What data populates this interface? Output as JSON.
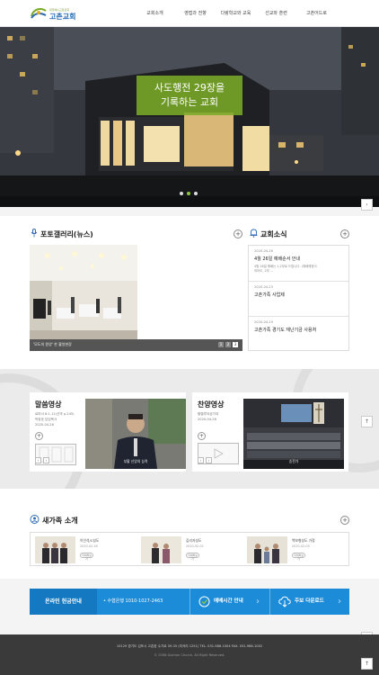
{
  "header": {
    "logo_sub": "대한예수교장로회",
    "logo_text": "고촌교회",
    "nav": [
      "교회소개",
      "영접과 전향",
      "다랑학교와 교육",
      "선교와 훈련",
      "고촌어드로"
    ]
  },
  "hero": {
    "caption_line1": "사도행전 29장을",
    "caption_line2": "기록하는 교회",
    "next_label": "›"
  },
  "photo_gallery": {
    "title": "포토갤러리(뉴스)",
    "caption": "'모도의 원양' 한 활영현장",
    "pager": [
      "1",
      "2",
      "3"
    ]
  },
  "church_news": {
    "title": "교회소식",
    "items": [
      {
        "date": "2020-04-26",
        "title": "4월 26일 예배순서 안내",
        "desc1": "4월 26일 예배는 1,2부로 드립니다. (예배예정이",
        "desc2": "되어도, 2부 ..."
      },
      {
        "date": "2020-04-23",
        "title": "고촌가족 사업제",
        "desc1": "",
        "desc2": ""
      },
      {
        "date": "2020-04-19",
        "title": "고촌가족 경기도 재난기금 사용처",
        "desc1": "",
        "desc2": ""
      }
    ]
  },
  "sermon": {
    "title": "말씀영상",
    "line1": "로마서 6:1-11(신약 p.245)",
    "line2": "박정호 담임목사",
    "line3": "2020-04-26",
    "caption": "부활 신앙의 능력"
  },
  "praise": {
    "title": "찬양영상",
    "line1": "할렐루야성가대",
    "line2": "2020-04-26",
    "caption": "승전가"
  },
  "new_family": {
    "title": "새가족 소개",
    "items": [
      {
        "name": "이인석/C성도",
        "date": "2020-02-16",
        "more": "자세히보기"
      },
      {
        "name": "김리자성도",
        "date": "2020-02-02",
        "more": "자세히보기"
      },
      {
        "name": "백보형성도 가정",
        "date": "2020-02-03",
        "more": "자세히보기"
      }
    ]
  },
  "quick": {
    "offering": "온라인 헌금안내",
    "bank": "• 수협은행 1010-1027-2463",
    "worship": "예배시간 안내",
    "bulletin": "주보 다운로드"
  },
  "footer": {
    "address": "10129 경기도 김포시 고촌읍 수기로 39-35 (미곡리 1251)   TEL. 031-986-1004   FAX. 031-986-1002",
    "copyright": "© 2008 Gochon Church. All Right Reserved."
  },
  "colors": {
    "accent_green": "#7aaa28",
    "quick_blue": "#1c8bd8",
    "footer": "#3a3a3a"
  }
}
